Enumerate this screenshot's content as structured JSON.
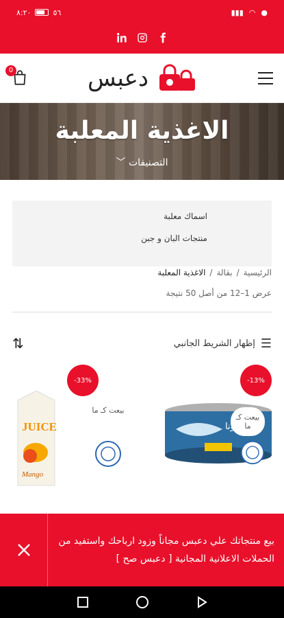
{
  "status_bar": {
    "time": "٨:٢٠",
    "battery": "٥٦"
  },
  "social": {
    "icons": [
      "linkedin-icon",
      "instagram-icon",
      "facebook-icon"
    ]
  },
  "header": {
    "cart_count": "0",
    "logo_text": "دعبس"
  },
  "hero": {
    "title": "الاغذية المعلبة",
    "categories_label": "التصنيفات"
  },
  "categories": [
    "اسماك معلبة",
    "منتجات البان و جبن"
  ],
  "breadcrumb": {
    "home": "الرئيسية",
    "sep": "/",
    "grocery": "بقالة",
    "current": "الاغذية المعلبة"
  },
  "result_count": "عرض 1–12 من أصل 50 نتيجة",
  "filter": {
    "sidebar_label": "إظهار الشريط الجانبي"
  },
  "products": [
    {
      "discount": "-13%",
      "sold_by": "بيعت كـ ما",
      "brand": "لونا"
    },
    {
      "discount": "-33%",
      "sold_by": "بيعت كـ ما",
      "brand": "JUICE",
      "flavor": "Mango"
    }
  ],
  "promo": {
    "text": "بيع منتجاتك علي دعبس مجاناً وزود ارباحك واستفيد من الحملات الاعلانية المجانية [ دعبس صح ]"
  },
  "colors": {
    "brand_red": "#e8102b"
  }
}
